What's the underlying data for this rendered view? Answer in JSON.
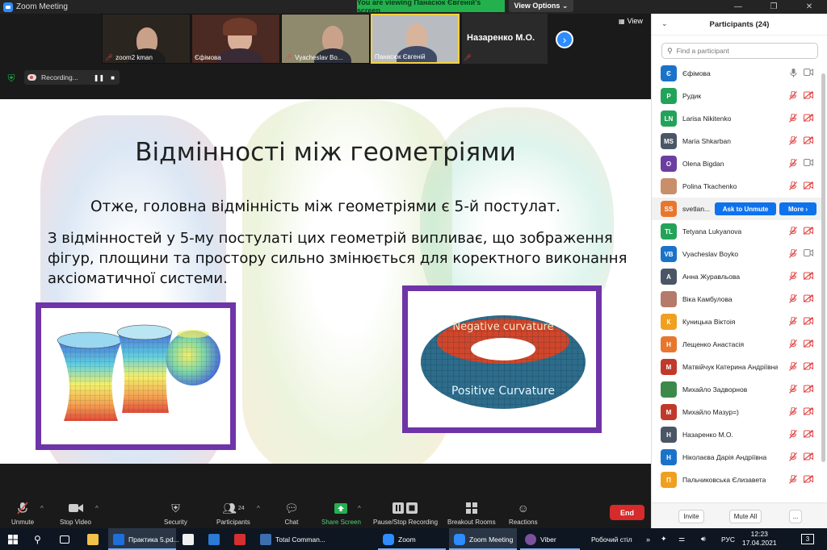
{
  "window": {
    "title": "Zoom Meeting",
    "viewing_banner": "You are viewing Панасюк Євгеній's screen",
    "view_options": "View Options ⌄",
    "minimize": "—",
    "maximize": "❐",
    "close": "✕"
  },
  "videos": {
    "tiles": [
      {
        "name": "zoom2 kman",
        "muted": true
      },
      {
        "name": "Єфімова",
        "muted": false
      },
      {
        "name": "Vyacheslav Bo...",
        "muted": true
      },
      {
        "name": "Панасюк Євгеній",
        "muted": false
      }
    ],
    "next_tile_name": "Назаренко М.О.",
    "next_arrow": "›",
    "view_label": "View"
  },
  "recording": {
    "label": "Recording...",
    "pause": "❚❚",
    "stop": "■"
  },
  "slide": {
    "title": "Відмінності між геометріями",
    "subtitle": "Отже, головна відмінність між геометріями є 5-й постулат.",
    "body": "З відмінностей у 5-му постулаті цих геометрій випливає, що зображення фігур, площини та простору сильно змінюється для коректного виконання аксіоматичної системи.",
    "torus_top_label": "Negative curvature",
    "torus_bottom_label": "Positive Curvature"
  },
  "toolbar": {
    "unmute": "Unmute",
    "stop_video": "Stop Video",
    "security": "Security",
    "participants": "Participants",
    "participants_count": "24",
    "chat": "Chat",
    "share_screen": "Share Screen",
    "pause_stop_recording": "Pause/Stop Recording",
    "breakout_rooms": "Breakout Rooms",
    "reactions": "Reactions",
    "end": "End",
    "caret": "^"
  },
  "participants_panel": {
    "title": "Participants (24)",
    "collapse": "⌄",
    "search_placeholder": "Find a participant",
    "ask_to_unmute": "Ask to Unmute",
    "more": "More ›",
    "invite": "Invite",
    "mute_all": "Mute All",
    "ellipsis": "...",
    "list": [
      {
        "initials": "Є",
        "name": "Єфімова",
        "color": "#1a73c9",
        "mic": "on",
        "video": "on"
      },
      {
        "initials": "Р",
        "name": " Рудик",
        "color": "#23a35a",
        "mic": "off",
        "video": "off"
      },
      {
        "initials": "LN",
        "name": "Larisa Nikitenko",
        "color": "#23a35a",
        "mic": "off",
        "video": "off"
      },
      {
        "initials": "MS",
        "name": "Maria Shkarban",
        "color": "#4a5666",
        "mic": "off",
        "video": "off"
      },
      {
        "initials": "O",
        "name": "Olena Bigdan",
        "color": "#6b3fa0",
        "mic": "off",
        "video": "on"
      },
      {
        "initials": "",
        "name": "Polina Tkachenko",
        "color": "#c98e6a",
        "mic": "off",
        "video": "off"
      },
      {
        "initials": "SS",
        "name": "svetlan...",
        "color": "#e8772e",
        "mic": "off",
        "video": "off"
      },
      {
        "initials": "TL",
        "name": "Tetyana Lukyanova",
        "color": "#23a35a",
        "mic": "off",
        "video": "off"
      },
      {
        "initials": "VB",
        "name": "Vyacheslav Boyko",
        "color": "#1a73c9",
        "mic": "off",
        "video": "on"
      },
      {
        "initials": "А",
        "name": "Анна Журавльова",
        "color": "#4a5666",
        "mic": "off",
        "video": "off"
      },
      {
        "initials": "",
        "name": "Віка Камбулова",
        "color": "#b47a6a",
        "mic": "off",
        "video": "off"
      },
      {
        "initials": "К",
        "name": "Куницька Віктоія",
        "color": "#f0a020",
        "mic": "off",
        "video": "off"
      },
      {
        "initials": "Н",
        "name": "Лещенко Анастасія",
        "color": "#e8772e",
        "mic": "off",
        "video": "off"
      },
      {
        "initials": "М",
        "name": "Матвійчук Катерина Андріївна",
        "color": "#c0392b",
        "mic": "off",
        "video": "off"
      },
      {
        "initials": "",
        "name": "Михайло Задворнов",
        "color": "#3c8a4a",
        "mic": "off",
        "video": "off"
      },
      {
        "initials": "М",
        "name": "Михайло Мазур=)",
        "color": "#c0392b",
        "mic": "off",
        "video": "off"
      },
      {
        "initials": "Н",
        "name": "Назаренко М.О.",
        "color": "#4a5666",
        "mic": "off",
        "video": "off"
      },
      {
        "initials": "Н",
        "name": "Ніколаєва Дарія Андріївна",
        "color": "#1a73c9",
        "mic": "off",
        "video": "off"
      },
      {
        "initials": "П",
        "name": "Пальчиковська Єлизавета",
        "color": "#f0a020",
        "mic": "off",
        "video": "off"
      }
    ]
  },
  "taskbar": {
    "items": [
      {
        "label": "Практика 5.pd...",
        "color": "#1e6fd9"
      },
      {
        "label": "Total Comman...",
        "color": "#3c6fb0"
      },
      {
        "label": "Zoom",
        "color": "#2d8cff"
      },
      {
        "label": "Zoom Meeting",
        "color": "#2d8cff"
      },
      {
        "label": "Viber",
        "color": "#7b519d"
      }
    ],
    "desktop_label": "Робочий стіл",
    "lang": "РУС",
    "time": "12:23",
    "date": "17.04.2021",
    "notifications": "3"
  }
}
